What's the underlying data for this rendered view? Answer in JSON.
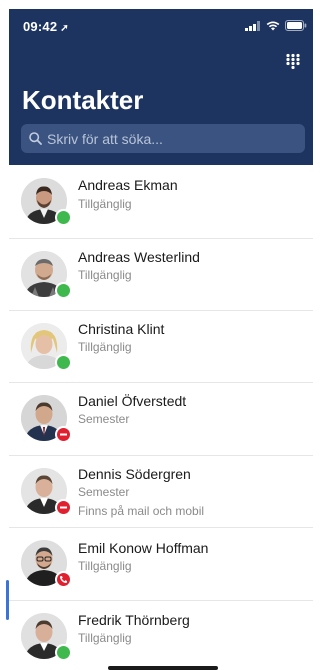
{
  "status_bar": {
    "time": "09:42",
    "location_icon": "location-arrow-icon",
    "signal_icon": "signal-icon",
    "wifi_icon": "wifi-icon",
    "battery_icon": "battery-icon"
  },
  "header": {
    "title": "Kontakter",
    "dialpad_icon": "dialpad-icon",
    "background_color": "#1d3461"
  },
  "search": {
    "placeholder": "Skriv för att söka...",
    "value": ""
  },
  "colors": {
    "available": "#3fb94d",
    "busy": "#e0202f"
  },
  "contacts": [
    {
      "name": "Andreas Ekman",
      "status": "Tillgänglig",
      "presence": "available",
      "note": ""
    },
    {
      "name": "Andreas Westerlind",
      "status": "Tillgänglig",
      "presence": "available",
      "note": ""
    },
    {
      "name": "Christina Klint",
      "status": "Tillgänglig",
      "presence": "available",
      "note": ""
    },
    {
      "name": "Daniel Öfverstedt",
      "status": "Semester",
      "presence": "busy",
      "note": ""
    },
    {
      "name": "Dennis Södergren",
      "status": "Semester",
      "presence": "busy",
      "note": "Finns på mail och mobil"
    },
    {
      "name": "Emil Konow Hoffman",
      "status": "Tillgänglig",
      "presence": "on-call",
      "note": ""
    },
    {
      "name": "Fredrik Thörnberg",
      "status": "Tillgänglig",
      "presence": "available",
      "note": ""
    }
  ]
}
